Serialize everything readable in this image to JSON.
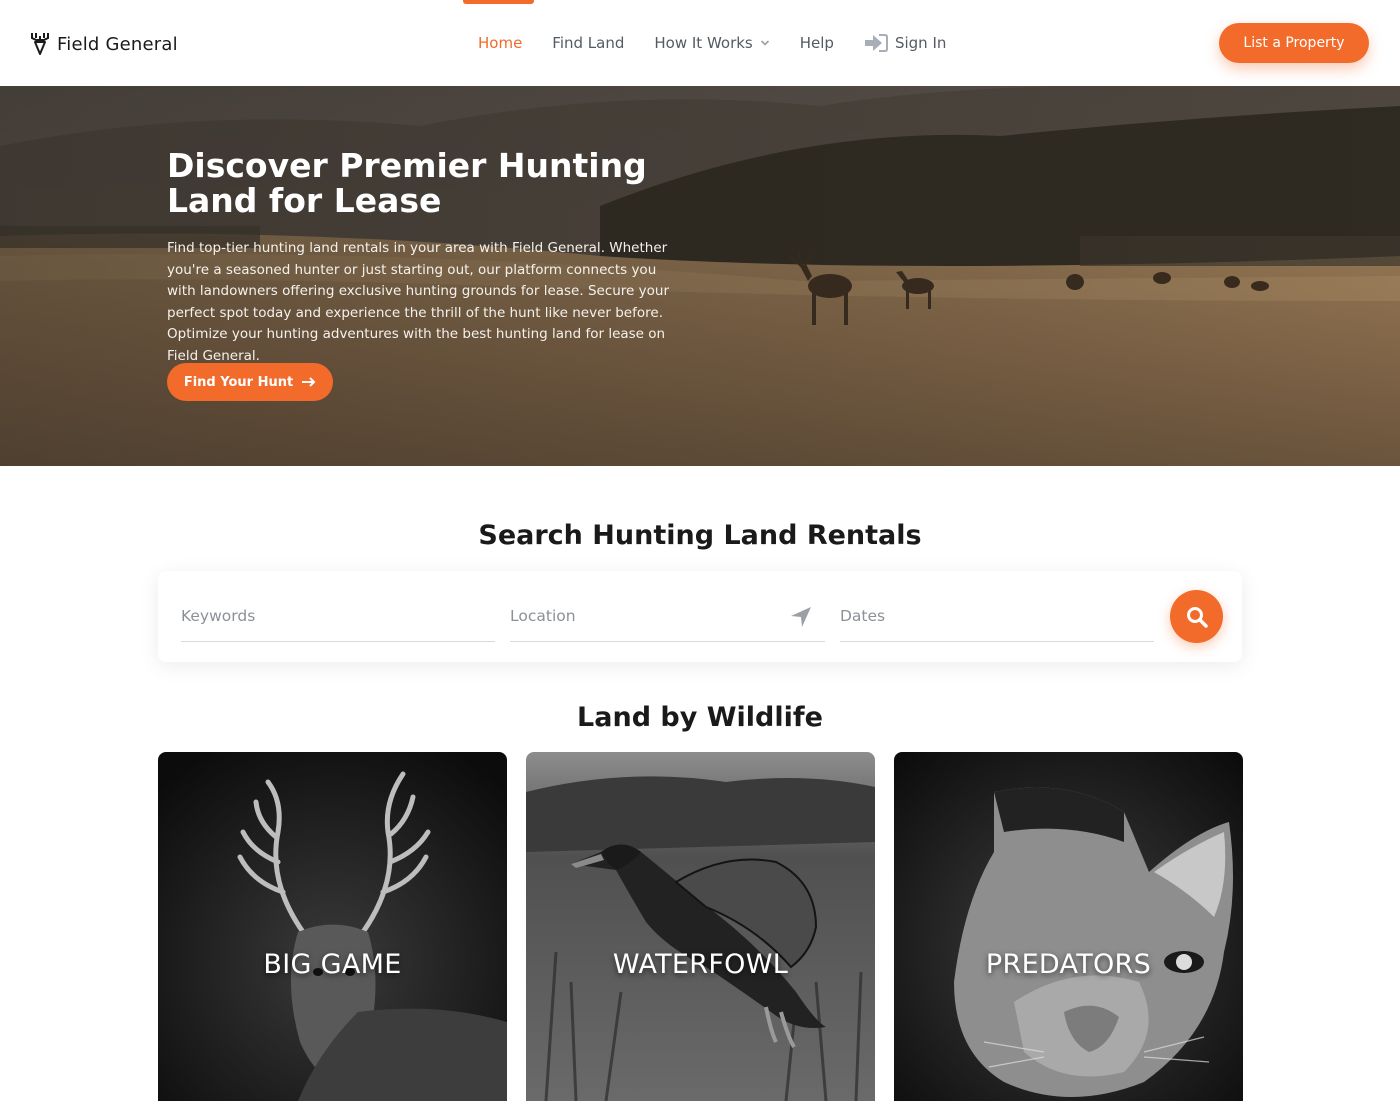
{
  "header": {
    "logo_text": "Field General",
    "nav": [
      {
        "label": "Home",
        "active": true
      },
      {
        "label": "Find Land",
        "active": false
      },
      {
        "label": "How It Works",
        "active": false,
        "has_dropdown": true
      },
      {
        "label": "Help",
        "active": false
      }
    ],
    "sign_in_label": "Sign In",
    "list_property_label": "List a Property"
  },
  "hero": {
    "title": "Discover Premier Hunting Land for Lease",
    "description": "Find top-tier hunting land rentals in your area with Field General. Whether you're a seasoned hunter or just starting out, our platform connects you with landowners offering exclusive hunting grounds for lease. Secure your perfect spot today and experience the thrill of the hunt like never before. Optimize your hunting adventures with the best hunting land for lease on Field General.",
    "cta_label": "Find Your Hunt"
  },
  "search": {
    "title": "Search Hunting Land Rentals",
    "keywords_placeholder": "Keywords",
    "location_placeholder": "Location",
    "dates_placeholder": "Dates"
  },
  "wildlife": {
    "title": "Land by Wildlife",
    "cards": [
      {
        "label": "BIG GAME"
      },
      {
        "label": "WATERFOWL"
      },
      {
        "label": "PREDATORS"
      }
    ]
  },
  "colors": {
    "accent": "#f26b2a",
    "text_dark": "#1a1a1a",
    "nav_text": "#555b63"
  },
  "icons": {
    "logo": "deer-antler-logo-icon",
    "sign_in": "sign-in-arrow-icon",
    "dropdown": "chevron-down-icon",
    "location": "location-arrow-icon",
    "search": "search-icon",
    "cta_arrow": "arrow-right-icon"
  }
}
